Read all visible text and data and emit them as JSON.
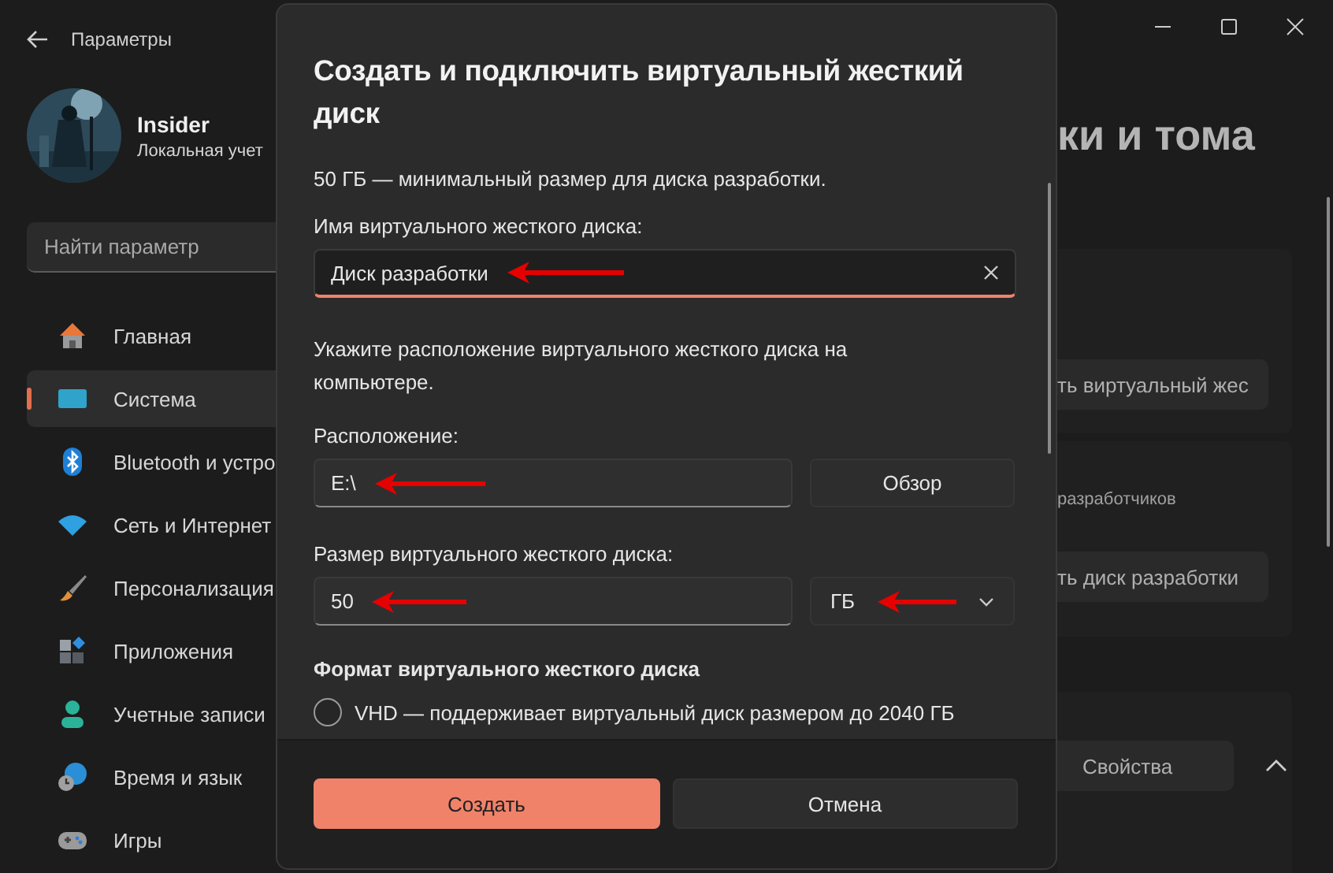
{
  "window": {
    "title": "Параметры"
  },
  "user": {
    "name": "Insider",
    "account": "Локальная учет"
  },
  "search": {
    "placeholder": "Найти параметр"
  },
  "nav": [
    {
      "label": "Главная",
      "kind": "home",
      "selected": false
    },
    {
      "label": "Система",
      "kind": "system",
      "selected": true
    },
    {
      "label": "Bluetooth и устро",
      "kind": "bluetooth",
      "selected": false
    },
    {
      "label": "Сеть и Интернет",
      "kind": "network",
      "selected": false
    },
    {
      "label": "Персонализация",
      "kind": "brush",
      "selected": false
    },
    {
      "label": "Приложения",
      "kind": "apps",
      "selected": false
    },
    {
      "label": "Учетные записи",
      "kind": "accounts",
      "selected": false
    },
    {
      "label": "Время и язык",
      "kind": "time",
      "selected": false
    },
    {
      "label": "Игры",
      "kind": "games",
      "selected": false
    }
  ],
  "page": {
    "title": "ки и тома",
    "create_vhd_button": "ть виртуальный жес",
    "dev_drive_text": "разработчиков",
    "dev_drive_button": "ть диск разработки",
    "properties_button": "Свойства",
    "expanded": true
  },
  "dialog": {
    "title": "Создать и подключить виртуальный жесткий диск",
    "note": "50 ГБ — минимальный размер для диска разработки.",
    "name_label": "Имя виртуального жесткого диска:",
    "name_value": "Диск разработки",
    "name_focused": true,
    "location_hint": "Укажите расположение виртуального жесткого диска на компьютере.",
    "location_label": "Расположение:",
    "location_value": "E:\\",
    "browse_button": "Обзор",
    "size_label": "Размер виртуального жесткого диска:",
    "size_value": "50",
    "unit": "ГБ",
    "format_heading": "Формат виртуального жесткого диска",
    "formats": [
      {
        "label": "VHD — поддерживает виртуальный диск размером до 2040 ГБ",
        "selected": false
      }
    ],
    "primary_button": "Создать",
    "secondary_button": "Отмена"
  }
}
